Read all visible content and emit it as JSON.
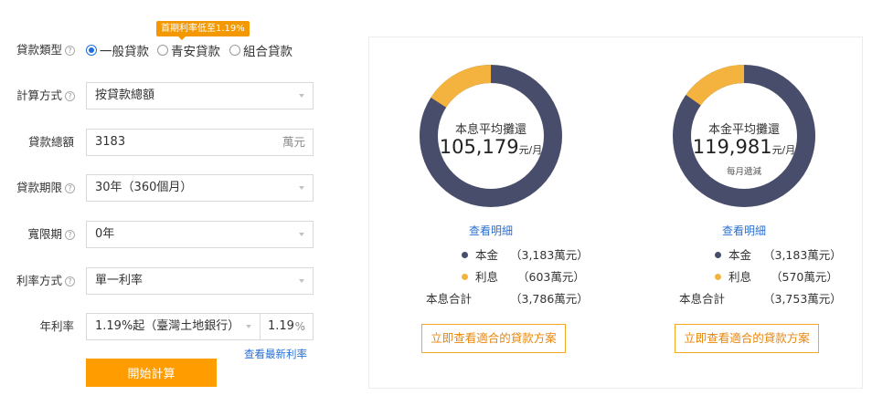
{
  "form": {
    "loan_type": {
      "label": "貸款類型",
      "options": [
        "一般貸款",
        "青安貸款",
        "組合貸款"
      ],
      "selected": "一般貸款",
      "tooltip": "首期利率低至1.19%"
    },
    "calc_method": {
      "label": "計算方式",
      "value": "按貸款總額"
    },
    "loan_amount": {
      "label": "貸款總額",
      "value": "3183",
      "unit": "萬元"
    },
    "loan_term": {
      "label": "貸款期限",
      "value": "30年（360個月）"
    },
    "grace_period": {
      "label": "寬限期",
      "value": "0年"
    },
    "rate_method": {
      "label": "利率方式",
      "value": "單一利率"
    },
    "annual_rate": {
      "label": "年利率",
      "select_value": "1.19%起（臺灣土地銀行）",
      "rate_value": "1.19",
      "rate_unit": "%",
      "latest_link": "查看最新利率"
    },
    "submit_label": "開始計算"
  },
  "results": [
    {
      "title": "本息平均攤還",
      "amount": "105,179",
      "amount_unit": "元/月",
      "subnote": "",
      "detail_link": "查看明細",
      "principal_label": "本金",
      "principal_value": "（3,183萬元）",
      "interest_label": "利息",
      "interest_value": "（603萬元）",
      "total_label": "本息合計",
      "total_value": "（3,786萬元）",
      "cta_label": "立即查看適合的貸款方案",
      "principal_share": 0.8407,
      "interest_share": 0.1593
    },
    {
      "title": "本金平均攤還",
      "amount": "119,981",
      "amount_unit": "元/月",
      "subnote": "每月遞減",
      "detail_link": "查看明細",
      "principal_label": "本金",
      "principal_value": "（3,183萬元）",
      "interest_label": "利息",
      "interest_value": "（570萬元）",
      "total_label": "本息合計",
      "total_value": "（3,753萬元）",
      "cta_label": "立即查看適合的貸款方案",
      "principal_share": 0.8481,
      "interest_share": 0.1519
    }
  ],
  "colors": {
    "principal": "#484d6b",
    "interest": "#f4b33f",
    "accent": "#ff9c00",
    "link": "#2b6fd0",
    "radio": "#1e6fd9"
  },
  "icons": {
    "help": "help-circle-icon",
    "dropdown": "chevron-down-icon"
  }
}
